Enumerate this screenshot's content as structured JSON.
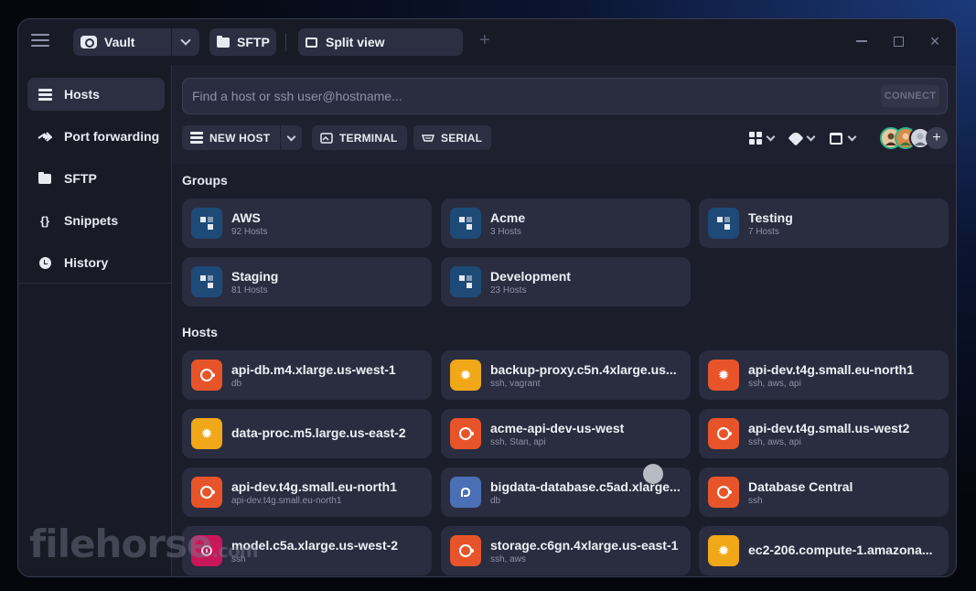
{
  "titlebar": {
    "vault_label": "Vault",
    "sftp_label": "SFTP",
    "split_label": "Split view",
    "add_tab": "+",
    "close_glyph": "×"
  },
  "sidebar": {
    "items": [
      {
        "label": "Hosts",
        "icon": "server-icon"
      },
      {
        "label": "Port forwarding",
        "icon": "arrow-right-icon"
      },
      {
        "label": "SFTP",
        "icon": "folder-icon"
      },
      {
        "label": "Snippets",
        "icon": "braces-icon"
      },
      {
        "label": "History",
        "icon": "clock-icon"
      }
    ],
    "snippets_glyph": "{}"
  },
  "search": {
    "placeholder": "Find a host or ssh user@hostname...",
    "connect_label": "CONNECT"
  },
  "toolbar": {
    "new_host_label": "NEW HOST",
    "terminal_label": "TERMINAL",
    "serial_label": "SERIAL",
    "add_member": "+"
  },
  "groups": {
    "title": "Groups",
    "items": [
      {
        "name": "AWS",
        "count": "92 Hosts"
      },
      {
        "name": "Acme",
        "count": "3 Hosts"
      },
      {
        "name": "Testing",
        "count": "7 Hosts"
      },
      {
        "name": "Staging",
        "count": "81 Hosts"
      },
      {
        "name": "Development",
        "count": "23 Hosts"
      }
    ]
  },
  "hosts": {
    "title": "Hosts",
    "items": [
      {
        "name": "api-db.m4.xlarge.us-west-1",
        "tags": "db",
        "os": "ubuntu",
        "color": "#e8542a"
      },
      {
        "name": "backup-proxy.c5n.4xlarge.us...",
        "tags": "ssh, vagrant",
        "os": "gear",
        "color": "#f0a818"
      },
      {
        "name": "api-dev.t4g.small.eu-north1",
        "tags": "ssh, aws, api",
        "os": "gear",
        "color": "#e8542a"
      },
      {
        "name": "data-proc.m5.large.us-east-2",
        "tags": "",
        "os": "gear",
        "color": "#f0a818"
      },
      {
        "name": "acme-api-dev-us-west",
        "tags": "ssh, Stan, api",
        "os": "ubuntu",
        "color": "#e8542a"
      },
      {
        "name": "api-dev.t4g.small.us-west2",
        "tags": "ssh, aws, api",
        "os": "ubuntu",
        "color": "#e8542a"
      },
      {
        "name": "api-dev.t4g.small.eu-north1",
        "tags": "api-dev.t4g.small.eu-north1",
        "os": "ubuntu",
        "color": "#e8542a"
      },
      {
        "name": "bigdata-database.c5ad.xlarge...",
        "tags": "db",
        "os": "fedora",
        "color": "#4a6fb5"
      },
      {
        "name": "Database Central",
        "tags": "ssh",
        "os": "ubuntu",
        "color": "#e8542a"
      },
      {
        "name": "model.c5a.xlarge.us-west-2",
        "tags": "ssh",
        "os": "debian",
        "color": "#c8175a"
      },
      {
        "name": "storage.c6gn.4xlarge.us-east-1",
        "tags": "ssh, aws",
        "os": "ubuntu",
        "color": "#e8542a"
      },
      {
        "name": "ec2-206.compute-1.amazona...",
        "tags": "",
        "os": "gear",
        "color": "#f0a818"
      }
    ]
  },
  "watermark": {
    "brand": "filehorse",
    "suffix": ".com"
  },
  "colors": {
    "group_icon_bg": "#1e4a78",
    "accent": "#2a2d3f",
    "avatar_ring": "#2fb58a"
  }
}
